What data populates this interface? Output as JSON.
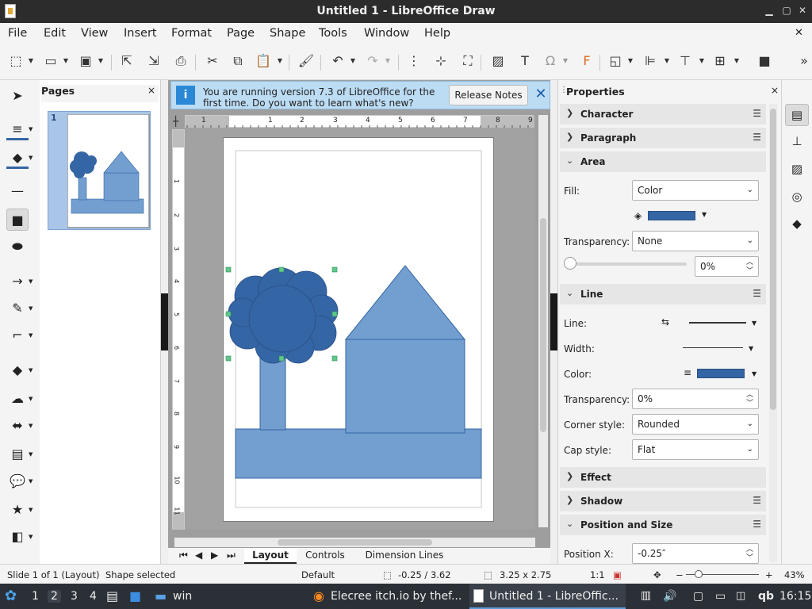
{
  "window": {
    "title": "Untitled 1 - LibreOffice Draw"
  },
  "menu": [
    "File",
    "Edit",
    "View",
    "Insert",
    "Format",
    "Page",
    "Shape",
    "Tools",
    "Window",
    "Help"
  ],
  "pages_panel": {
    "title": "Pages",
    "page_number": "1"
  },
  "infobar": {
    "message": "You are running version 7.3 of LibreOffice for the first time. Do you want to learn what's new?",
    "button": "Release Notes"
  },
  "ruler": {
    "h_labels": [
      "1",
      "1",
      "2",
      "3",
      "4",
      "5",
      "6",
      "7",
      "8",
      "9"
    ],
    "v_labels": [
      "1",
      "2",
      "3",
      "4",
      "5",
      "6",
      "7",
      "8",
      "9",
      "10",
      "11"
    ]
  },
  "sheet_tabs": [
    "Layout",
    "Controls",
    "Dimension Lines"
  ],
  "properties": {
    "title": "Properties",
    "sections": {
      "character": "Character",
      "paragraph": "Paragraph",
      "area": "Area",
      "line": "Line",
      "effect": "Effect",
      "shadow": "Shadow",
      "position": "Position and Size"
    },
    "area": {
      "fill_label": "Fill:",
      "fill_value": "Color",
      "fill_color": "#3465a4",
      "transparency_label": "Transparency:",
      "transparency_value": "None",
      "transparency_pct": "0%"
    },
    "line": {
      "line_label": "Line:",
      "width_label": "Width:",
      "color_label": "Color:",
      "color": "#3465a4",
      "transparency_label": "Transparency:",
      "transparency_value": "0%",
      "corner_label": "Corner style:",
      "corner_value": "Rounded",
      "cap_label": "Cap style:",
      "cap_value": "Flat"
    },
    "position": {
      "x_label": "Position X:",
      "x_value": "-0.25″"
    }
  },
  "status": {
    "slide": "Slide 1 of 1 (Layout)",
    "selection": "Shape selected",
    "style": "Default",
    "position": "-0.25 / 3.62",
    "size": "3.25 x 2.75",
    "scale": "1:1",
    "zoom": "43%"
  },
  "taskbar": {
    "workspaces": [
      "1",
      "2",
      "3",
      "4"
    ],
    "folder_label": "win",
    "apps": [
      "Elecree itch.io by thef...",
      "Untitled 1 - LibreOffic..."
    ],
    "time": "16:15"
  },
  "colors": {
    "shape_fill": "#729fcf",
    "tree_fill": "#3465a4"
  }
}
